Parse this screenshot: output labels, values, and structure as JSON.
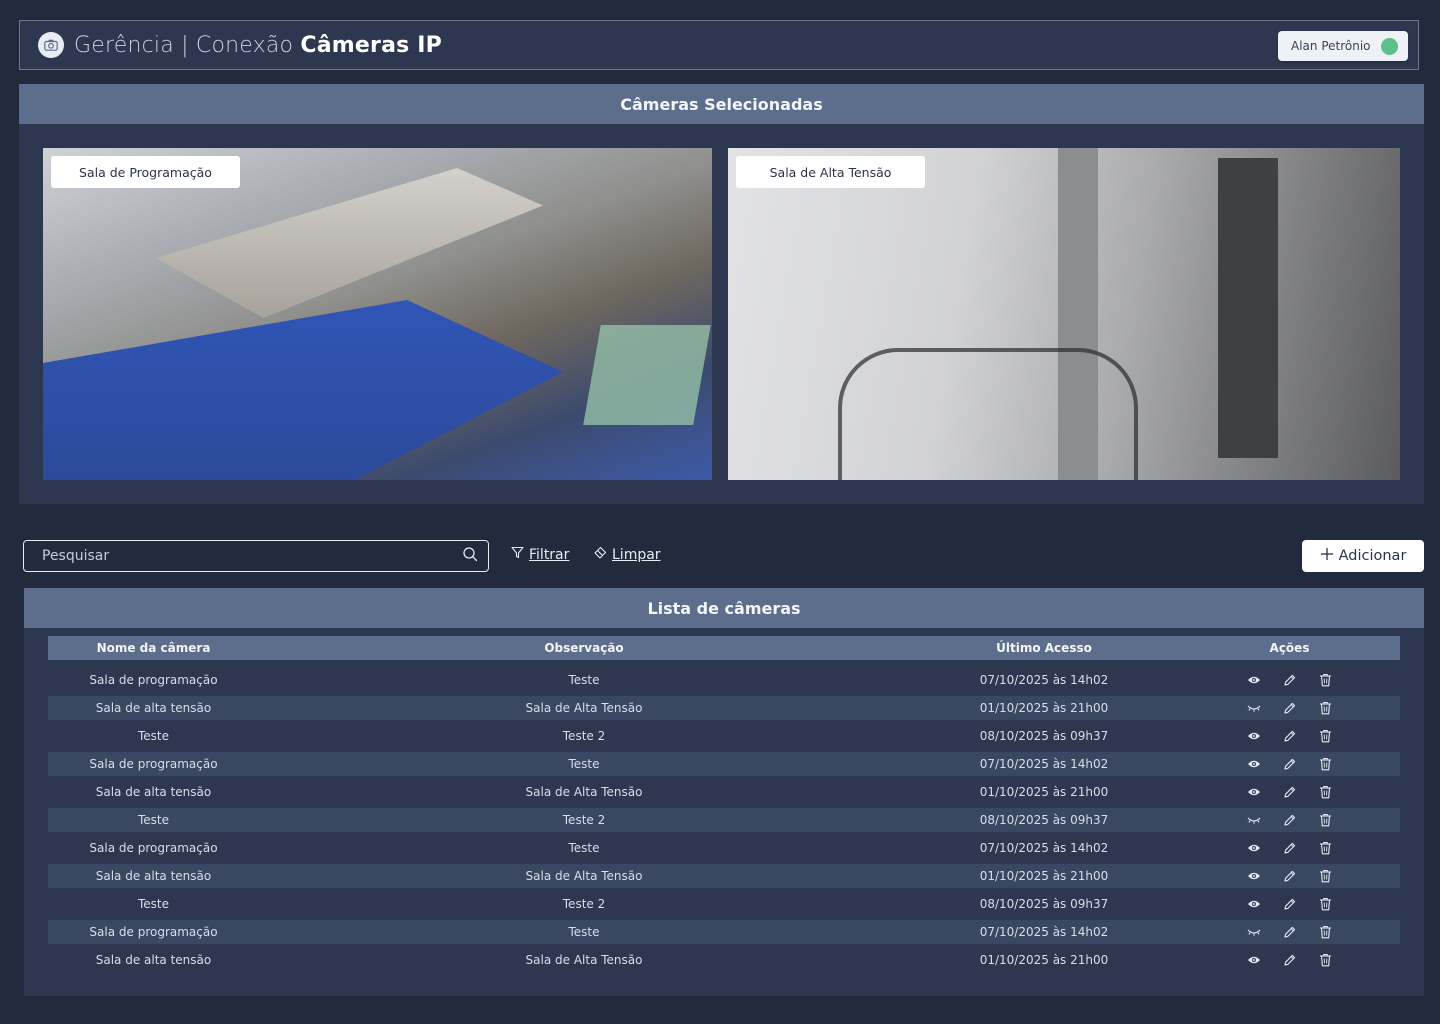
{
  "header": {
    "title_prefix": "Gerência | Conexão ",
    "title_bold": "Câmeras IP",
    "user_name": "Alan Petrônio",
    "status_color": "#5fbf8a"
  },
  "selected_cameras": {
    "title": "Câmeras Selecionadas",
    "cameras": [
      {
        "label": "Sala de Programação"
      },
      {
        "label": "Sala de Alta Tensão"
      }
    ]
  },
  "toolbar": {
    "search_placeholder": "Pesquisar",
    "filter_label": "Filtrar",
    "clear_label": "Limpar",
    "add_label": "Adicionar"
  },
  "camera_list": {
    "title": "Lista de câmeras",
    "columns": [
      "Nome da câmera",
      "Observação",
      "Último Acesso",
      "Ações"
    ],
    "rows": [
      {
        "name": "Sala de programação",
        "note": "Teste",
        "last": "07/10/2025 às 14h02",
        "visible": true
      },
      {
        "name": "Sala de alta tensão",
        "note": "Sala de Alta Tensão",
        "last": "01/10/2025 às 21h00",
        "visible": false
      },
      {
        "name": "Teste",
        "note": "Teste 2",
        "last": "08/10/2025 às 09h37",
        "visible": true
      },
      {
        "name": "Sala de programação",
        "note": "Teste",
        "last": "07/10/2025 às 14h02",
        "visible": true
      },
      {
        "name": "Sala de alta tensão",
        "note": "Sala de Alta Tensão",
        "last": "01/10/2025 às 21h00",
        "visible": true
      },
      {
        "name": "Teste",
        "note": "Teste 2",
        "last": "08/10/2025 às 09h37",
        "visible": false
      },
      {
        "name": "Sala de programação",
        "note": "Teste",
        "last": "07/10/2025 às 14h02",
        "visible": true
      },
      {
        "name": "Sala de alta tensão",
        "note": "Sala de Alta Tensão",
        "last": "01/10/2025 às 21h00",
        "visible": true
      },
      {
        "name": "Teste",
        "note": "Teste 2",
        "last": "08/10/2025 às 09h37",
        "visible": true
      },
      {
        "name": "Sala de programação",
        "note": "Teste",
        "last": "07/10/2025 às 14h02",
        "visible": false
      },
      {
        "name": "Sala de alta tensão",
        "note": "Sala de Alta Tensão",
        "last": "01/10/2025 às 21h00",
        "visible": true
      }
    ]
  }
}
